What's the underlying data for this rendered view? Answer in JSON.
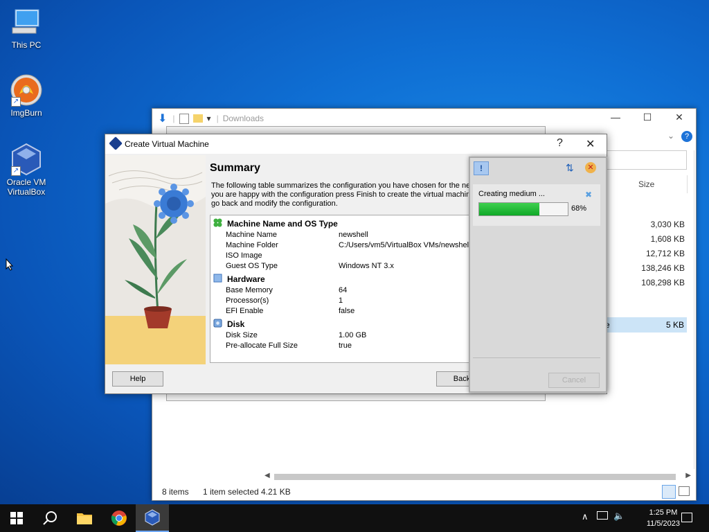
{
  "desktop": {
    "icons": [
      {
        "label": "This PC",
        "icon": "this-pc-icon"
      },
      {
        "label": "ImgBurn",
        "icon": "imgburn-icon"
      },
      {
        "label": "Oracle VM VirtualBox",
        "icon": "virtualbox-icon"
      }
    ]
  },
  "explorer": {
    "title": "Downloads",
    "column_size": "Size",
    "sizes": [
      "3,030 KB",
      "1,608 KB",
      "12,712 KB",
      "138,246 KB",
      "108,298 KB",
      "5 KB"
    ],
    "selected_fragment": "e",
    "status_items": "8 items",
    "status_selected": "1 item selected",
    "status_size": "4.21 KB"
  },
  "dialog": {
    "title": "Create Virtual Machine",
    "help_glyph": "?",
    "close_glyph": "✕",
    "heading": "Summary",
    "description": [
      "The following table summarizes the configuration you have chosen for the new",
      "you are happy with the configuration press Finish to create the virtual machine",
      "go back and modify the configuration."
    ],
    "sections": [
      {
        "title": "Machine Name and OS Type",
        "rows": [
          {
            "key": "Machine Name",
            "value": "newshell"
          },
          {
            "key": "Machine Folder",
            "value": "C:/Users/vm5/VirtualBox VMs/newshell"
          },
          {
            "key": "ISO Image",
            "value": ""
          },
          {
            "key": "Guest OS Type",
            "value": "Windows NT 3.x"
          }
        ]
      },
      {
        "title": "Hardware",
        "rows": [
          {
            "key": "Base Memory",
            "value": "64"
          },
          {
            "key": "Processor(s)",
            "value": "1"
          },
          {
            "key": "EFI Enable",
            "value": "false"
          }
        ]
      },
      {
        "title": "Disk",
        "rows": [
          {
            "key": "Disk Size",
            "value": "1.00 GB"
          },
          {
            "key": "Pre-allocate Full Size",
            "value": "true"
          }
        ]
      }
    ],
    "help_button": "Help",
    "back_button": "Back"
  },
  "progress": {
    "label": "Creating medium ...",
    "percent_text": "68%",
    "fraction": 0.68,
    "cancel_button": "Cancel"
  },
  "taskbar": {
    "time": "1:25 PM",
    "date": "11/5/2023"
  },
  "colors": {
    "progress_fill": "#1fb838",
    "desktop": "#0f6fd4",
    "taskbar": "#101010"
  }
}
